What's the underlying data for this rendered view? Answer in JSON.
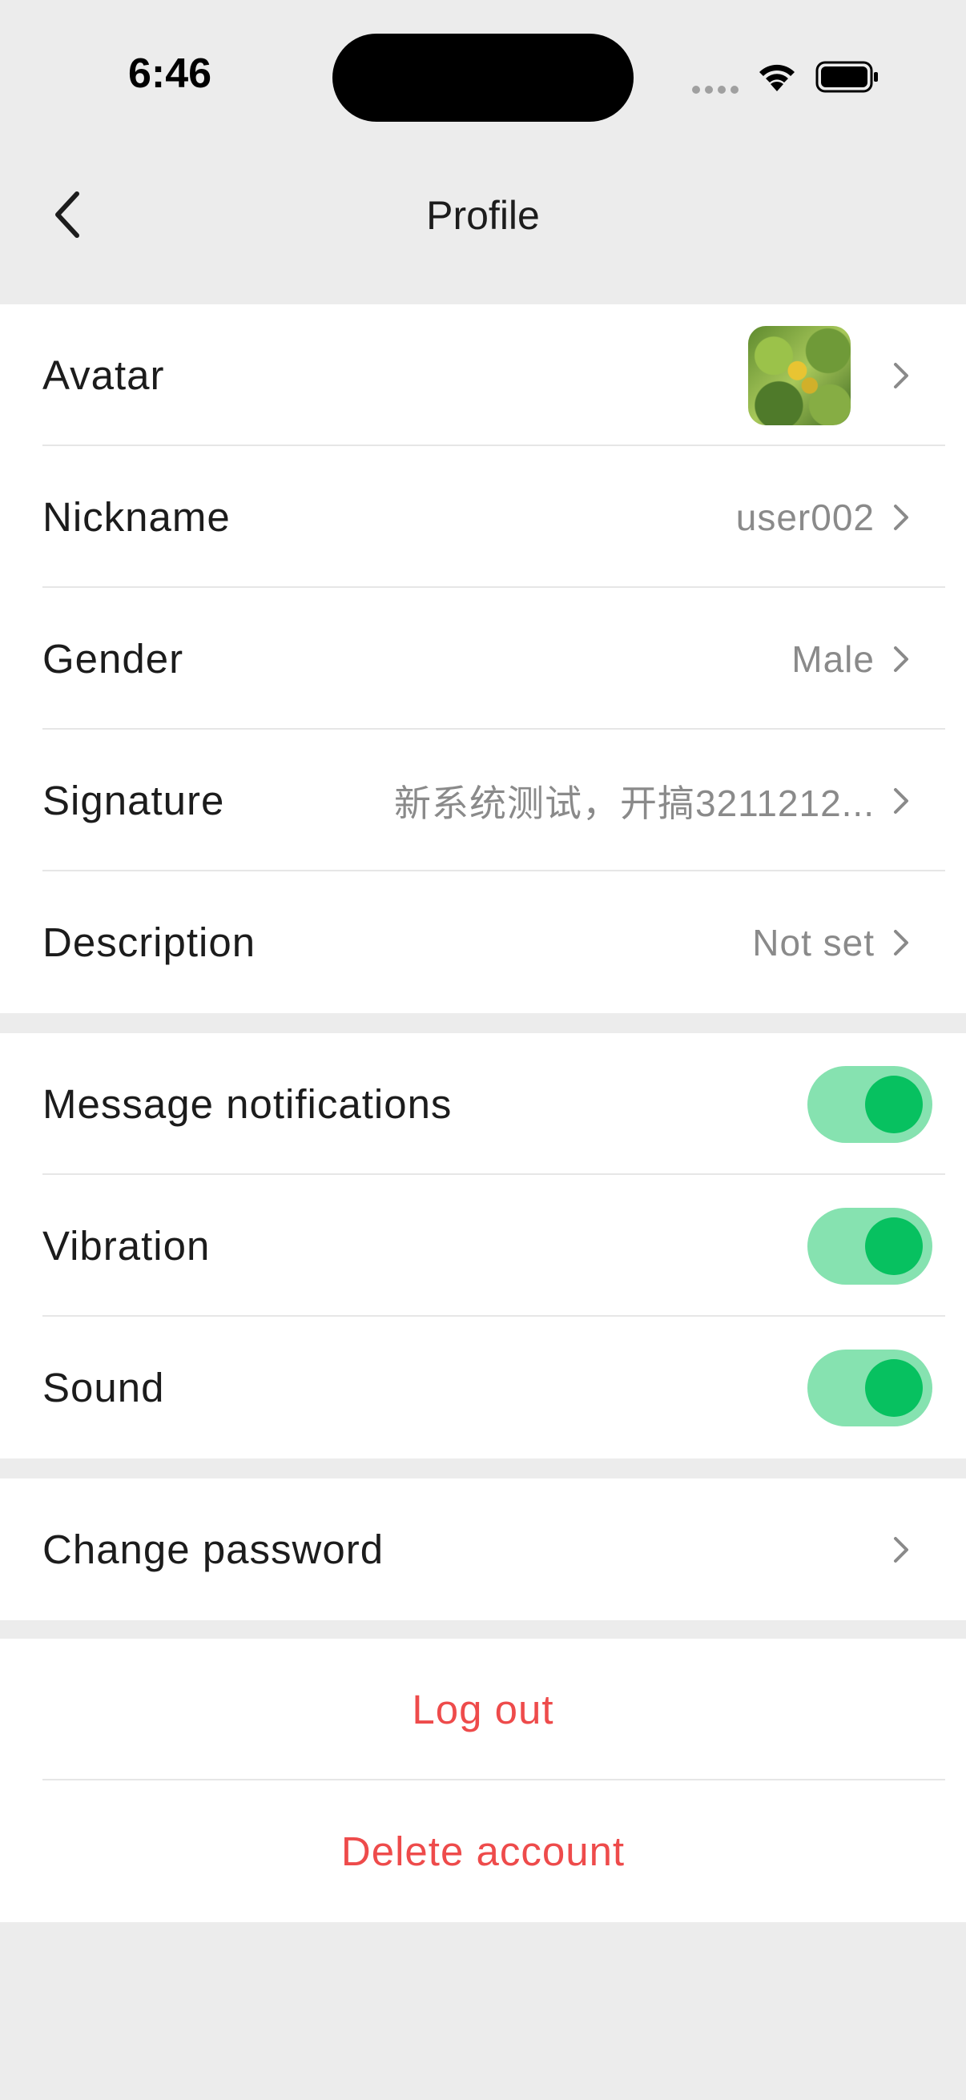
{
  "status_bar": {
    "time": "6:46"
  },
  "nav": {
    "title": "Profile",
    "back_icon": "chevron-left-icon"
  },
  "profile": {
    "avatar_label": "Avatar",
    "nickname_label": "Nickname",
    "nickname_value": "user002",
    "gender_label": "Gender",
    "gender_value": "Male",
    "signature_label": "Signature",
    "signature_value": "新系统测试，开搞3211212...",
    "description_label": "Description",
    "description_value": "Not set"
  },
  "settings": {
    "message_notifications_label": "Message notifications",
    "message_notifications_on": true,
    "vibration_label": "Vibration",
    "vibration_on": true,
    "sound_label": "Sound",
    "sound_on": true
  },
  "security": {
    "change_password_label": "Change password"
  },
  "account": {
    "logout_label": "Log out",
    "delete_label": "Delete account"
  },
  "colors": {
    "toggle_track": "#86e2b0",
    "toggle_knob": "#07c160",
    "danger": "#ee4b4b",
    "background": "#ececec"
  }
}
